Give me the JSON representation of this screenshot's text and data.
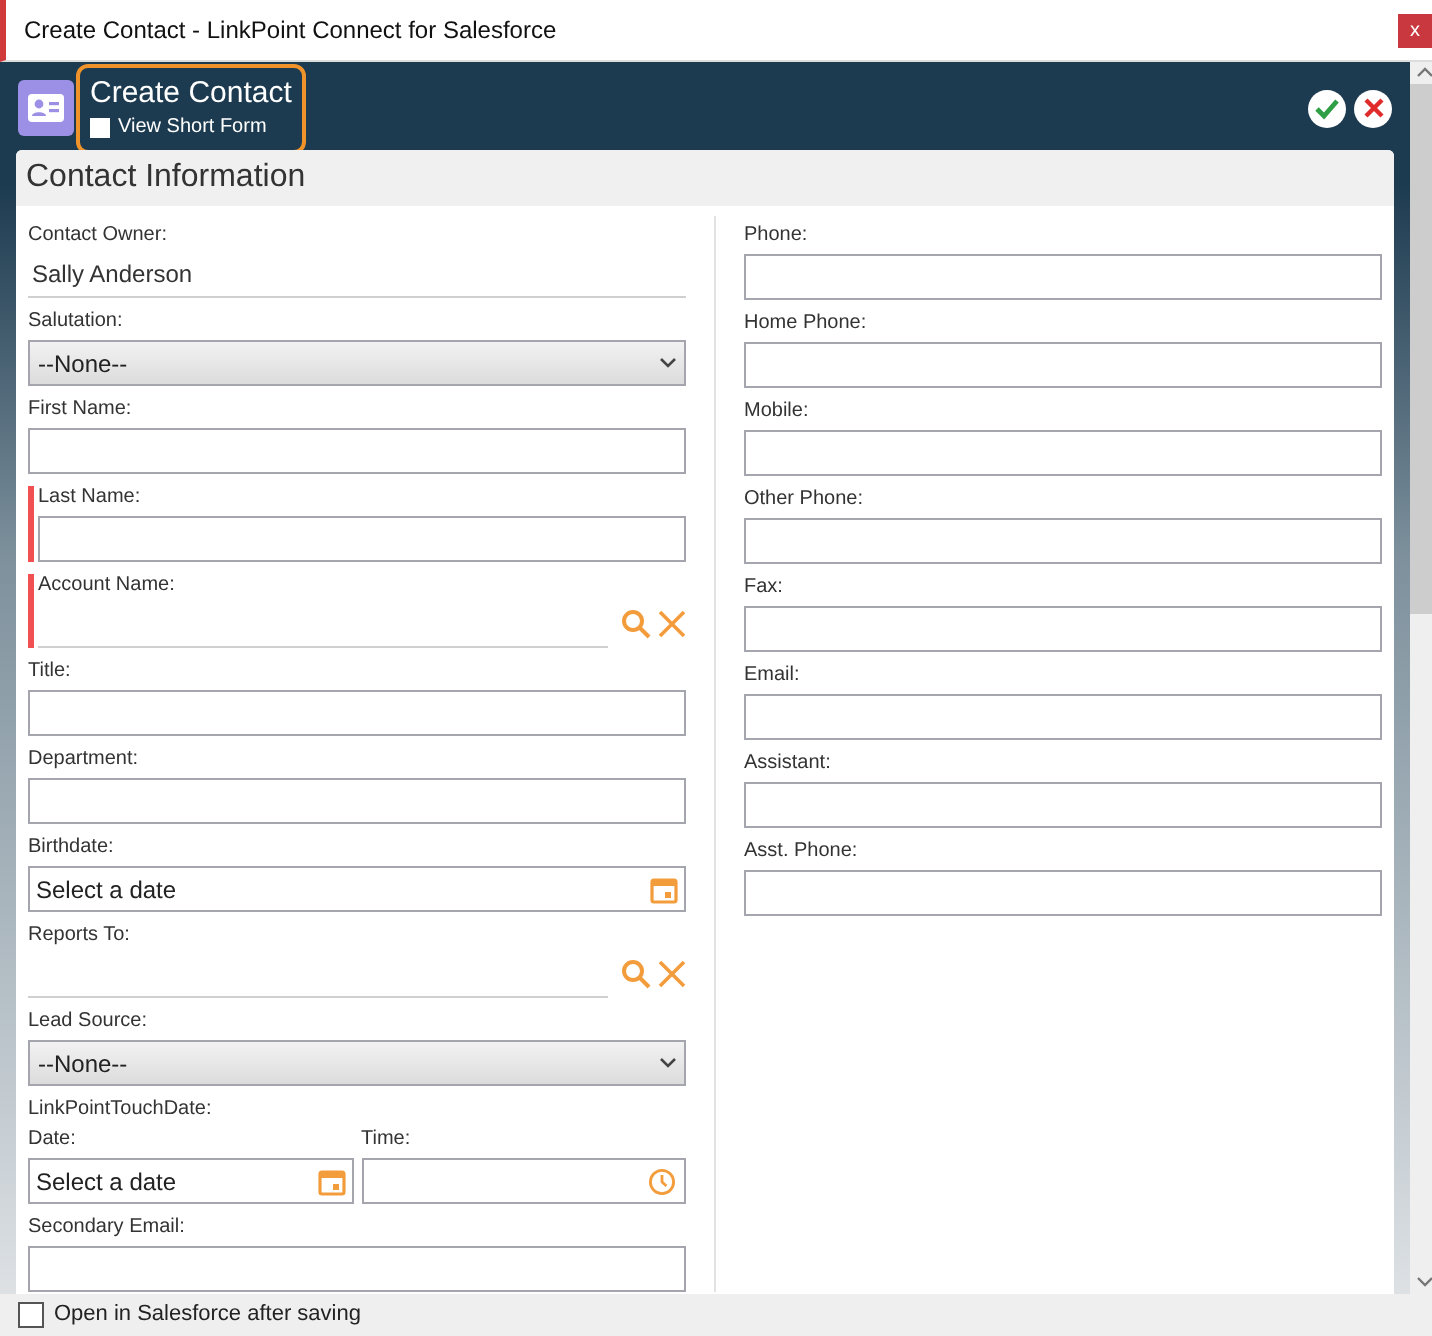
{
  "window": {
    "title": "Create Contact - LinkPoint Connect for Salesforce",
    "close": "x"
  },
  "header": {
    "title": "Create Contact",
    "short_form": {
      "label": "View Short Form",
      "checked": false
    }
  },
  "section": {
    "title": "Contact Information"
  },
  "left_fields": [
    {
      "kind": "readonly",
      "label": "Contact Owner:",
      "value": "Sally Anderson",
      "required": false
    },
    {
      "kind": "select",
      "label": "Salutation:",
      "value": "--None--",
      "required": false
    },
    {
      "kind": "text",
      "label": "First Name:",
      "required": false
    },
    {
      "kind": "text",
      "label": "Last Name:",
      "required": true
    },
    {
      "kind": "lookup",
      "label": "Account Name:",
      "required": true
    },
    {
      "kind": "text",
      "label": "Title:",
      "required": false
    },
    {
      "kind": "text",
      "label": "Department:",
      "required": false
    },
    {
      "kind": "date",
      "label": "Birthdate:",
      "placeholder": "Select a date",
      "required": false
    },
    {
      "kind": "lookup",
      "label": "Reports To:",
      "required": false
    },
    {
      "kind": "select",
      "label": "Lead Source:",
      "value": "--None--",
      "required": false
    },
    {
      "kind": "datetime",
      "label": "LinkPointTouchDate:",
      "date_label": "Date:",
      "placeholder": "Select a date",
      "time_label": "Time:",
      "required": false
    },
    {
      "kind": "text",
      "label": "Secondary Email:",
      "required": false
    }
  ],
  "right_fields": [
    {
      "kind": "text",
      "label": "Phone:",
      "required": false
    },
    {
      "kind": "text",
      "label": "Home Phone:",
      "required": false
    },
    {
      "kind": "text",
      "label": "Mobile:",
      "required": false
    },
    {
      "kind": "text",
      "label": "Other Phone:",
      "required": false
    },
    {
      "kind": "text",
      "label": "Fax:",
      "required": false
    },
    {
      "kind": "text",
      "label": "Email:",
      "required": false
    },
    {
      "kind": "text",
      "label": "Assistant:",
      "required": false
    },
    {
      "kind": "text",
      "label": "Asst. Phone:",
      "required": false
    }
  ],
  "footer": {
    "label": "Open in Salesforce after saving",
    "checked": false
  }
}
